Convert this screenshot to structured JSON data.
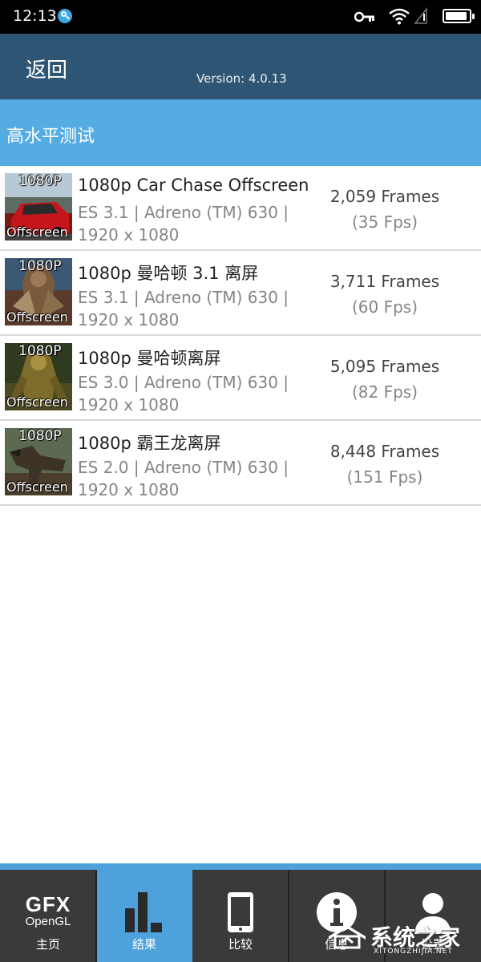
{
  "status": {
    "time": "12:13"
  },
  "appbar": {
    "back_label": "返回",
    "version": "Version: 4.0.13"
  },
  "section": {
    "title": "高水平测试"
  },
  "results": [
    {
      "tag": "1080P",
      "label": "Offscreen",
      "title": "1080p Car Chase Offscreen",
      "info_line1": "ES 3.1 | Adreno (TM) 630 |",
      "info_line2": "1920 x 1080",
      "frames": "2,059 Frames",
      "fps": "(35 Fps)"
    },
    {
      "tag": "1080P",
      "label": "Offscreen",
      "title": "1080p 曼哈顿 3.1 离屏",
      "info_line1": "ES 3.1 | Adreno (TM) 630 |",
      "info_line2": "1920 x 1080",
      "frames": "3,711 Frames",
      "fps": "(60 Fps)"
    },
    {
      "tag": "1080P",
      "label": "Offscreen",
      "title": "1080p 曼哈顿离屏",
      "info_line1": "ES 3.0 | Adreno (TM) 630 |",
      "info_line2": "1920 x 1080",
      "frames": "5,095 Frames",
      "fps": "(82 Fps)"
    },
    {
      "tag": "1080P",
      "label": "Offscreen",
      "title": "1080p 霸王龙离屏",
      "info_line1": "ES 2.0 | Adreno (TM) 630 |",
      "info_line2": "1920 x 1080",
      "frames": "8,448 Frames",
      "fps": "(151 Fps)"
    }
  ],
  "tabs": {
    "home": {
      "logo_top": "GFX",
      "logo_bottom": "OpenGL",
      "label": "主页"
    },
    "results": {
      "label": "结果"
    },
    "compare": {
      "label": "比较"
    },
    "info": {
      "label": "信息"
    },
    "settings": {
      "label": "设置"
    }
  },
  "watermark": {
    "text": "系统之家",
    "sub": "XITONGZHIJIA.NET"
  },
  "colors": {
    "appbar": "#2e5674",
    "section_header": "#55ace3",
    "tab_active": "#4da2dc",
    "tab_inactive": "#3a3a3a"
  }
}
